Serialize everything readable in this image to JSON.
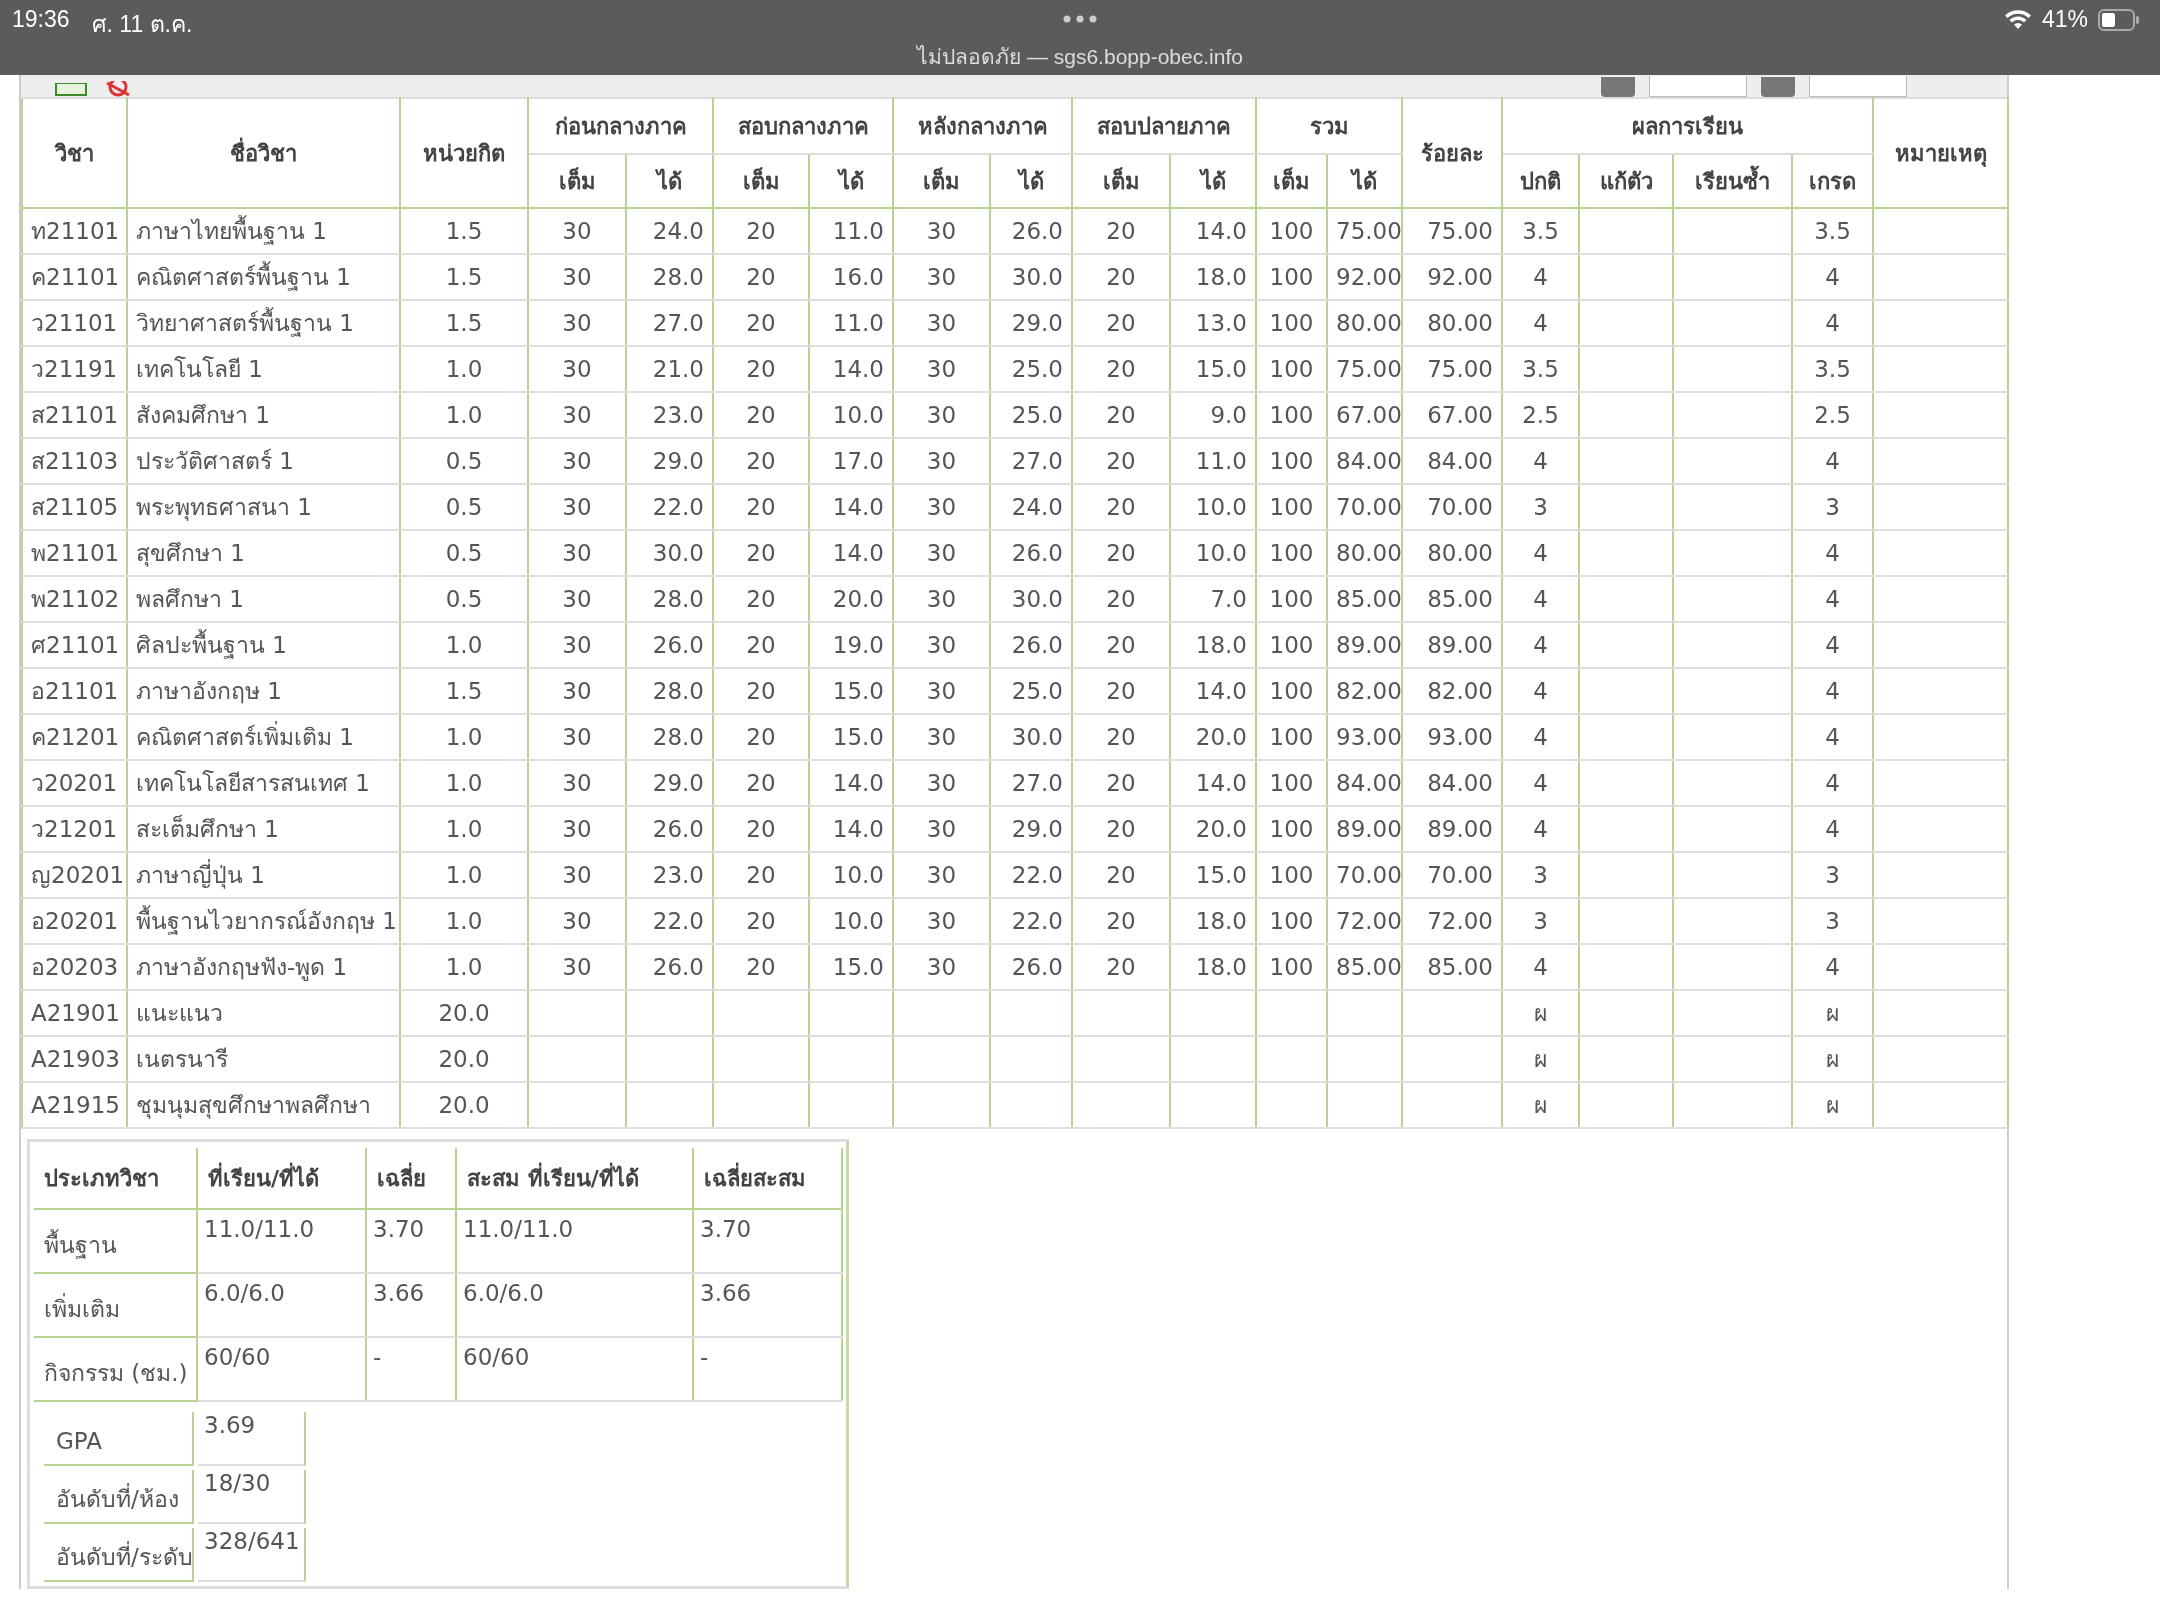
{
  "status_bar": {
    "time": "19:36",
    "date": "ศ. 11 ต.ค.",
    "battery": "41%",
    "address": "ไม่ปลอดภัย — sgs6.bopp-obec.info"
  },
  "grades_table": {
    "columns": [
      {
        "label": "วิชา"
      },
      {
        "label": "ชื่อวิชา"
      },
      {
        "label": "หน่วยกิต"
      },
      {
        "label": "ก่อนกลางภาค",
        "sub": [
          "เต็ม",
          "ได้"
        ]
      },
      {
        "label": "สอบกลางภาค",
        "sub": [
          "เต็ม",
          "ได้"
        ]
      },
      {
        "label": "หลังกลางภาค",
        "sub": [
          "เต็ม",
          "ได้"
        ]
      },
      {
        "label": "สอบปลายภาค",
        "sub": [
          "เต็ม",
          "ได้"
        ]
      },
      {
        "label": "รวม",
        "sub": [
          "เต็ม",
          "ได้"
        ]
      },
      {
        "label": "ร้อยละ"
      },
      {
        "label": "ผลการเรียน",
        "sub": [
          "ปกติ",
          "แก้ตัว",
          "เรียนซ้ำ",
          "เกรด"
        ]
      },
      {
        "label": "หมายเหตุ"
      }
    ],
    "rows": [
      {
        "code": "ท21101",
        "name": "ภาษาไทยพื้นฐาน 1",
        "credits": "1.5",
        "scores": [
          "30",
          "24.0",
          "20",
          "11.0",
          "30",
          "26.0",
          "20",
          "14.0",
          "100",
          "75.00"
        ],
        "percent": "75.00",
        "result": "3.5",
        "grade": "3.5"
      },
      {
        "code": "ค21101",
        "name": "คณิตศาสตร์พื้นฐาน 1",
        "credits": "1.5",
        "scores": [
          "30",
          "28.0",
          "20",
          "16.0",
          "30",
          "30.0",
          "20",
          "18.0",
          "100",
          "92.00"
        ],
        "percent": "92.00",
        "result": "4",
        "grade": "4"
      },
      {
        "code": "ว21101",
        "name": "วิทยาศาสตร์พื้นฐาน 1",
        "credits": "1.5",
        "scores": [
          "30",
          "27.0",
          "20",
          "11.0",
          "30",
          "29.0",
          "20",
          "13.0",
          "100",
          "80.00"
        ],
        "percent": "80.00",
        "result": "4",
        "grade": "4"
      },
      {
        "code": "ว21191",
        "name": "เทคโนโลยี 1",
        "credits": "1.0",
        "scores": [
          "30",
          "21.0",
          "20",
          "14.0",
          "30",
          "25.0",
          "20",
          "15.0",
          "100",
          "75.00"
        ],
        "percent": "75.00",
        "result": "3.5",
        "grade": "3.5"
      },
      {
        "code": "ส21101",
        "name": "สังคมศึกษา 1",
        "credits": "1.0",
        "scores": [
          "30",
          "23.0",
          "20",
          "10.0",
          "30",
          "25.0",
          "20",
          "9.0",
          "100",
          "67.00"
        ],
        "percent": "67.00",
        "result": "2.5",
        "grade": "2.5"
      },
      {
        "code": "ส21103",
        "name": "ประวัติศาสตร์ 1",
        "credits": "0.5",
        "scores": [
          "30",
          "29.0",
          "20",
          "17.0",
          "30",
          "27.0",
          "20",
          "11.0",
          "100",
          "84.00"
        ],
        "percent": "84.00",
        "result": "4",
        "grade": "4"
      },
      {
        "code": "ส21105",
        "name": "พระพุทธศาสนา 1",
        "credits": "0.5",
        "scores": [
          "30",
          "22.0",
          "20",
          "14.0",
          "30",
          "24.0",
          "20",
          "10.0",
          "100",
          "70.00"
        ],
        "percent": "70.00",
        "result": "3",
        "grade": "3"
      },
      {
        "code": "พ21101",
        "name": "สุขศึกษา 1",
        "credits": "0.5",
        "scores": [
          "30",
          "30.0",
          "20",
          "14.0",
          "30",
          "26.0",
          "20",
          "10.0",
          "100",
          "80.00"
        ],
        "percent": "80.00",
        "result": "4",
        "grade": "4"
      },
      {
        "code": "พ21102",
        "name": "พลศึกษา 1",
        "credits": "0.5",
        "scores": [
          "30",
          "28.0",
          "20",
          "20.0",
          "30",
          "30.0",
          "20",
          "7.0",
          "100",
          "85.00"
        ],
        "percent": "85.00",
        "result": "4",
        "grade": "4"
      },
      {
        "code": "ศ21101",
        "name": "ศิลปะพื้นฐาน 1",
        "credits": "1.0",
        "scores": [
          "30",
          "26.0",
          "20",
          "19.0",
          "30",
          "26.0",
          "20",
          "18.0",
          "100",
          "89.00"
        ],
        "percent": "89.00",
        "result": "4",
        "grade": "4"
      },
      {
        "code": "อ21101",
        "name": "ภาษาอังกฤษ 1",
        "credits": "1.5",
        "scores": [
          "30",
          "28.0",
          "20",
          "15.0",
          "30",
          "25.0",
          "20",
          "14.0",
          "100",
          "82.00"
        ],
        "percent": "82.00",
        "result": "4",
        "grade": "4"
      },
      {
        "code": "ค21201",
        "name": "คณิตศาสตร์เพิ่มเติม 1",
        "credits": "1.0",
        "scores": [
          "30",
          "28.0",
          "20",
          "15.0",
          "30",
          "30.0",
          "20",
          "20.0",
          "100",
          "93.00"
        ],
        "percent": "93.00",
        "result": "4",
        "grade": "4"
      },
      {
        "code": "ว20201",
        "name": "เทคโนโลยีสารสนเทศ 1",
        "credits": "1.0",
        "scores": [
          "30",
          "29.0",
          "20",
          "14.0",
          "30",
          "27.0",
          "20",
          "14.0",
          "100",
          "84.00"
        ],
        "percent": "84.00",
        "result": "4",
        "grade": "4"
      },
      {
        "code": "ว21201",
        "name": "สะเต็มศึกษา 1",
        "credits": "1.0",
        "scores": [
          "30",
          "26.0",
          "20",
          "14.0",
          "30",
          "29.0",
          "20",
          "20.0",
          "100",
          "89.00"
        ],
        "percent": "89.00",
        "result": "4",
        "grade": "4"
      },
      {
        "code": "ญ20201",
        "name": "ภาษาญี่ปุ่น 1",
        "credits": "1.0",
        "scores": [
          "30",
          "23.0",
          "20",
          "10.0",
          "30",
          "22.0",
          "20",
          "15.0",
          "100",
          "70.00"
        ],
        "percent": "70.00",
        "result": "3",
        "grade": "3"
      },
      {
        "code": "อ20201",
        "name": "พื้นฐานไวยากรณ์อังกฤษ 1",
        "credits": "1.0",
        "scores": [
          "30",
          "22.0",
          "20",
          "10.0",
          "30",
          "22.0",
          "20",
          "18.0",
          "100",
          "72.00"
        ],
        "percent": "72.00",
        "result": "3",
        "grade": "3"
      },
      {
        "code": "อ20203",
        "name": "ภาษาอังกฤษฟัง-พูด 1",
        "credits": "1.0",
        "scores": [
          "30",
          "26.0",
          "20",
          "15.0",
          "30",
          "26.0",
          "20",
          "18.0",
          "100",
          "85.00"
        ],
        "percent": "85.00",
        "result": "4",
        "grade": "4"
      },
      {
        "code": "A21901",
        "name": "แนะแนว",
        "credits": "20.0",
        "result": "ผ",
        "grade": "ผ"
      },
      {
        "code": "A21903",
        "name": "เนตรนารี",
        "credits": "20.0",
        "result": "ผ",
        "grade": "ผ"
      },
      {
        "code": "A21915",
        "name": "ชุมนุมสุขศึกษาพลศึกษา",
        "credits": "20.0",
        "result": "ผ",
        "grade": "ผ"
      }
    ]
  },
  "summary": {
    "columns": [
      "ประเภทวิชา",
      "ที่เรียน/ที่ได้",
      "เฉลี่ย",
      "สะสม ที่เรียน/ที่ได้",
      "เฉลี่ยสะสม"
    ],
    "rows": [
      [
        "พื้นฐาน",
        "11.0/11.0",
        "3.70",
        "11.0/11.0",
        "3.70"
      ],
      [
        "เพิ่มเติม",
        "6.0/6.0",
        "3.66",
        "6.0/6.0",
        "3.66"
      ],
      [
        "กิจกรรม (ชม.)",
        "60/60",
        "-",
        "60/60",
        "-"
      ]
    ]
  },
  "ranking": [
    {
      "label": "GPA",
      "value": "3.69"
    },
    {
      "label": "อันดับที่/ห้อง",
      "value": "18/30"
    },
    {
      "label": "อันดับที่/ระดับ",
      "value": "328/641"
    }
  ]
}
